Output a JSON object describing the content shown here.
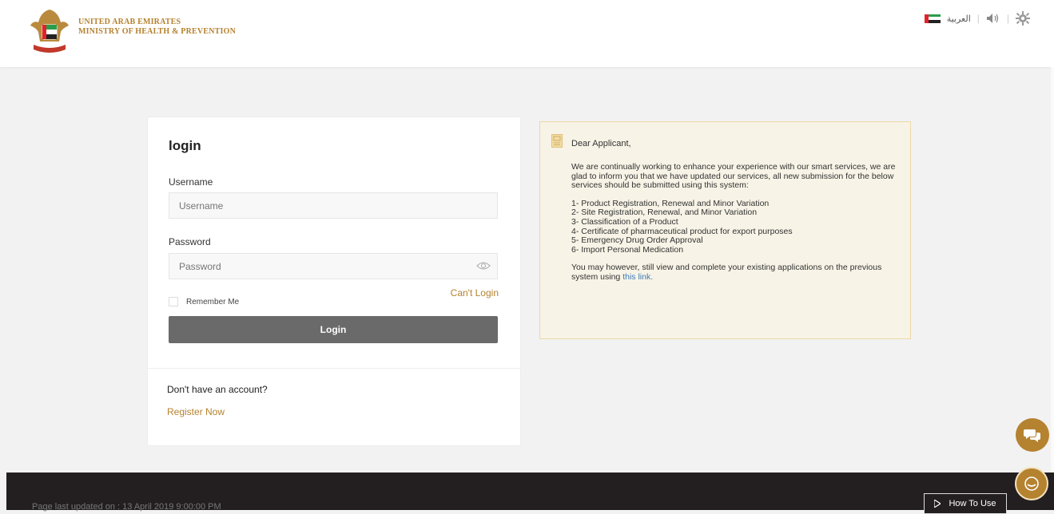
{
  "header": {
    "ministry_line1": "UNITED ARAB EMIRATES",
    "ministry_line2": "MINISTRY OF HEALTH & PREVENTION",
    "language_label": "العربية",
    "brand_color": "#b5822f"
  },
  "login": {
    "title": "login",
    "username_label": "Username",
    "username_placeholder": "Username",
    "password_label": "Password",
    "password_placeholder": "Password",
    "cant_login": "Can't Login",
    "remember_me": "Remember Me",
    "login_button": "Login",
    "no_account": "Don't have an account?",
    "register": "Register Now"
  },
  "notice": {
    "greeting": "Dear Applicant,",
    "intro": "We are continually working to enhance your experience with our smart services, we are glad to inform you that we have updated our services, all new submission for the below services should be submitted using this system:",
    "items": [
      "1- Product Registration, Renewal and Minor Variation",
      "2- Site Registration, Renewal, and Minor Variation",
      "3- Classification of a Product",
      "4- Certificate of pharmaceutical product for export purposes",
      "5- Emergency Drug Order Approval",
      "6- Import Personal Medication"
    ],
    "outro": "You may however, still view and complete your existing applications on the previous system using",
    "link_text": "this link."
  },
  "footer": {
    "last_updated": "Page last updated on :  13 April 2019 9:00:00 PM",
    "how_to_use": "How To Use"
  },
  "icons": {
    "flag": "uae-flag-icon",
    "speaker": "speaker-icon",
    "settings": "gear-icon",
    "eye": "eye-icon",
    "document": "document-icon",
    "chat": "chat-icon",
    "help": "help-circle-icon",
    "play": "play-icon"
  }
}
